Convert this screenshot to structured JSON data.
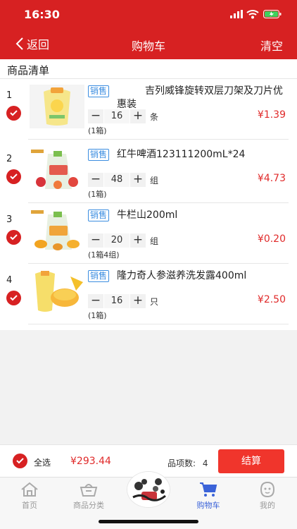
{
  "status_bar": {
    "time": "16:30"
  },
  "nav": {
    "back_label": "返回",
    "title": "购物车",
    "clear_label": "清空"
  },
  "list_header": "商品清单",
  "items": [
    {
      "index": "1",
      "tag": "销售",
      "name": "吉列威锋旋转双层刀架及刀片优惠装",
      "qty": "16",
      "unit": "条",
      "pack": "(1箱)",
      "price": "¥1.39"
    },
    {
      "index": "2",
      "tag": "销售",
      "name": "红牛啤酒123111200mL*24",
      "qty": "48",
      "unit": "组",
      "pack": "(1箱)",
      "price": "¥4.73"
    },
    {
      "index": "3",
      "tag": "销售",
      "name": "牛栏山200ml",
      "qty": "20",
      "unit": "组",
      "pack": "(1箱4组)",
      "price": "¥0.20"
    },
    {
      "index": "4",
      "tag": "销售",
      "name": "隆力奇人参滋养洗发露400ml",
      "qty": "16",
      "unit": "只",
      "pack": "(1箱)",
      "price": "¥2.50"
    }
  ],
  "footer": {
    "select_all": "全选",
    "total": "¥293.44",
    "count_label": "品项数:",
    "count": "4",
    "checkout": "结算"
  },
  "tabs": [
    {
      "label": "首页",
      "icon": "home-icon"
    },
    {
      "label": "商品分类",
      "icon": "basket-icon"
    },
    {
      "label": "购物车",
      "icon": "cart-icon"
    },
    {
      "label": "我的",
      "icon": "profile-icon"
    }
  ],
  "colors": {
    "brand_red": "#d72122",
    "price_red": "#e02a2a",
    "tag_blue": "#3b8de0",
    "tab_active": "#3b63d8",
    "checkout_red": "#f0352c"
  }
}
